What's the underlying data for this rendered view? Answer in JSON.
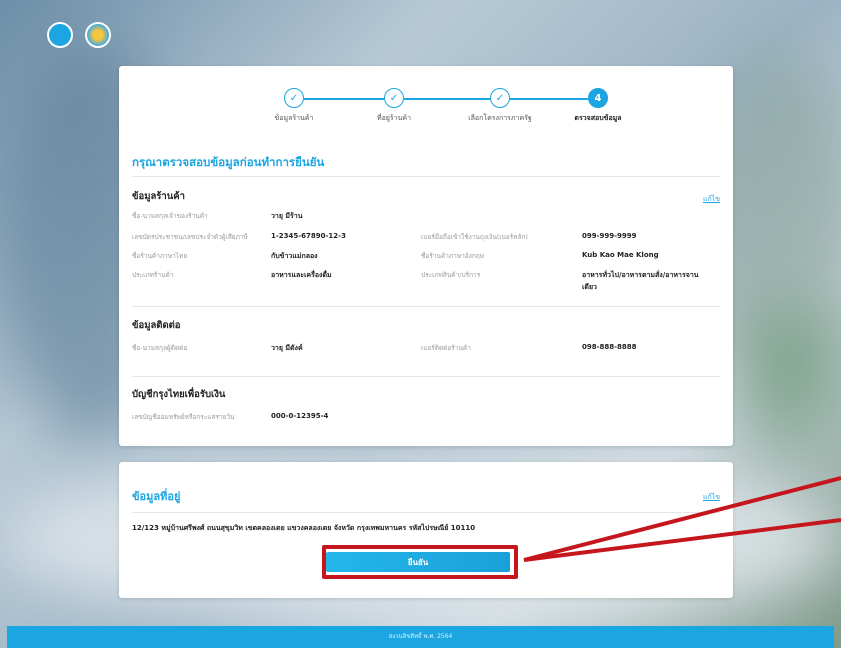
{
  "steps": [
    {
      "num": "✓",
      "label": "ข้อมูลร้านค้า",
      "done": true
    },
    {
      "num": "✓",
      "label": "ที่อยู่ร้านค้า",
      "done": true
    },
    {
      "num": "✓",
      "label": "เลือกโครงการภาครัฐ",
      "done": true
    },
    {
      "num": "4",
      "label": "ตรวจสอบข้อมูล",
      "done": false
    }
  ],
  "page_title": "กรุณาตรวจสอบข้อมูลก่อนทำการยืนยัน",
  "edit_label": "แก้ไข",
  "shop": {
    "title": "ข้อมูลร้านค้า",
    "owner_name_label": "ชื่อ-นามสกุลเจ้าของร้านค้า",
    "owner_name": "วายุ มีร้าน",
    "id_label": "เลขบัตรประชาชน/เลขประจำตัวผู้เสียภาษี",
    "id_value": "1-2345-67890-12-3",
    "phone_label": "เบอร์มือถือเข้าใช้งานถุงเงิน(เบอร์หลัก)",
    "phone_value": "099-999-9999",
    "name_th_label": "ชื่อร้านค้าภาษาไทย",
    "name_th": "กับข้าวแม่กลอง",
    "name_en_label": "ชื่อร้านค้าภาษาอังกฤษ",
    "name_en": "Kub Kao Mae Klong",
    "type_label": "ประเภทร้านค้า",
    "type_value": "อาหารและเครื่องดื่ม",
    "category_label": "ประเภทสินค้า/บริการ",
    "category_value_1": "อาหารทั่วไป/อาหารตามสั่ง/อาหารจาน",
    "category_value_2": "เดียว"
  },
  "contact": {
    "title": "ข้อมูลติดต่อ",
    "name_label": "ชื่อ-นามสกุลผู้ติดต่อ",
    "name_value": "วายุ มีตังค์",
    "phone_label": "เบอร์ติดต่อร้านค้า",
    "phone_value": "098-888-8888"
  },
  "bank": {
    "title": "บัญชีกรุงไทยเพื่อรับเงิน",
    "account_label": "เลขบัญชีออมทรัพย์หรือกระแสรายวัน",
    "account_value": "000-0-12395-4"
  },
  "address": {
    "title": "ข้อมูลที่อยู่",
    "value": "12/123 หมู่บ้านศรีพงศ์ ถนนสุขุมวิท เขตคลองเตย แขวงคลองเตย จังหวัด กรุงเทพมหานคร รหัสไปรษณีย์ 10110"
  },
  "confirm_label": "ยืนยัน",
  "footer": "สงวนลิขสิทธิ์ พ.ศ. 2564",
  "colors": {
    "accent": "#1ba5e1",
    "highlight": "#c4161c"
  }
}
